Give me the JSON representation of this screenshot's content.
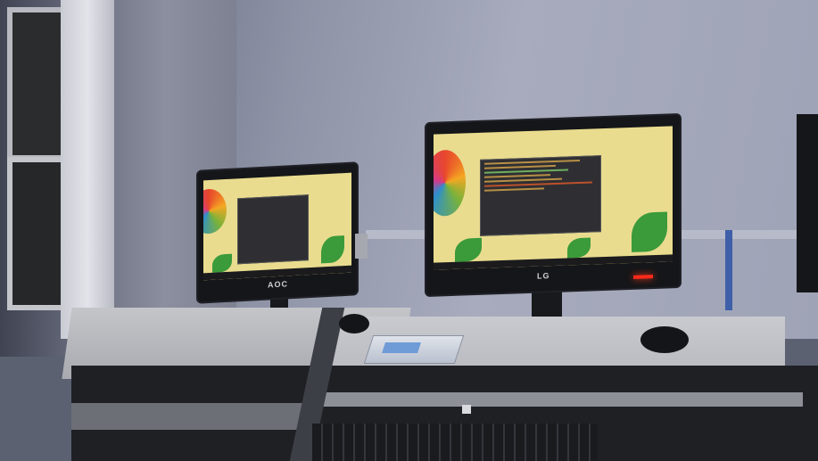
{
  "scene": {
    "description_free": true,
    "monitors": [
      {
        "brand": "AOC"
      },
      {
        "brand": "LG"
      }
    ]
  },
  "colors": {
    "wall": "#a7abbd",
    "desk": "#c4c5c9",
    "wallpaper": "#e9dc8f",
    "terminal": "#2f2f33",
    "power_led": "#ff2a1a"
  }
}
